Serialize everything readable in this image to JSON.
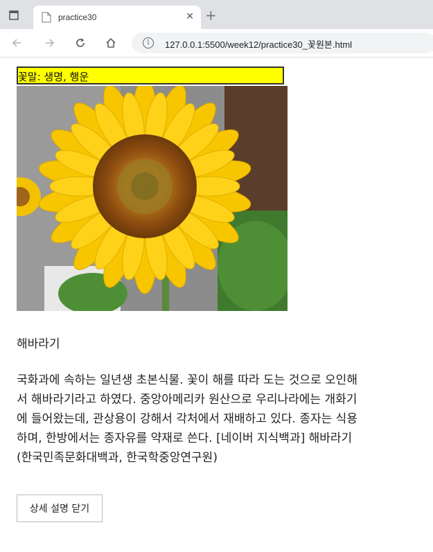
{
  "browser": {
    "tab_title": "practice30",
    "url": "127.0.0.1:5500/week12/practice30_꽃원본.html"
  },
  "page": {
    "caption": "꽃말: 생명, 행운",
    "heading": "해바라기",
    "description": "국화과에 속하는 일년생 초본식물. 꽃이 해를 따라 도는 것으로 오인해서 해바라기라고 하였다. 중앙아메리카 원산으로 우리나라에는 개화기에 들어왔는데, 관상용이 강해서 각처에서 재배하고 있다. 종자는 식용하며, 한방에서는 종자유를 약재로 쓴다. [네이버 지식백과] 해바라기 (한국민족문화대백과, 한국학중앙연구원)",
    "detail_button": "상세 설명 닫기"
  }
}
